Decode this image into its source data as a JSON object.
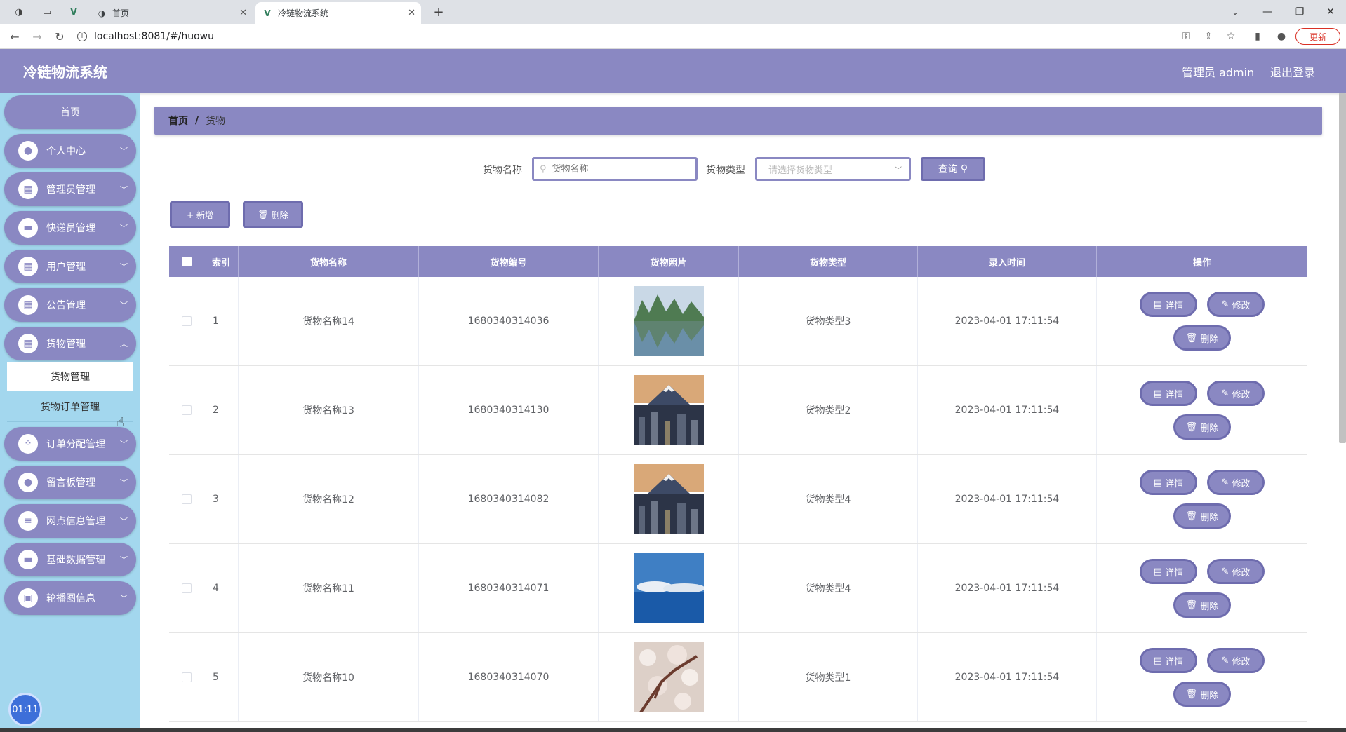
{
  "browser": {
    "tabs": [
      {
        "title": "首页",
        "active": false
      },
      {
        "title": "冷链物流系统",
        "active": true
      }
    ],
    "new_tab": "+",
    "url": "localhost:8081/#/huowu",
    "update_label": "更新"
  },
  "header": {
    "title": "冷链物流系统",
    "user": "管理员 admin",
    "logout": "退出登录"
  },
  "sidebar": {
    "items": [
      {
        "label": "首页",
        "icon": "home"
      },
      {
        "label": "个人中心",
        "icon": "person-icon"
      },
      {
        "label": "管理员管理",
        "icon": "grid-icon"
      },
      {
        "label": "快递员管理",
        "icon": "monitor-icon"
      },
      {
        "label": "用户管理",
        "icon": "grid-icon"
      },
      {
        "label": "公告管理",
        "icon": "grid-icon"
      },
      {
        "label": "货物管理",
        "icon": "grid-icon"
      },
      {
        "label": "订单分配管理",
        "icon": "apps-icon"
      },
      {
        "label": "留言板管理",
        "icon": "person-icon"
      },
      {
        "label": "网点信息管理",
        "icon": "sliders-icon"
      },
      {
        "label": "基础数据管理",
        "icon": "monitor-icon"
      },
      {
        "label": "轮播图信息",
        "icon": "image-icon"
      }
    ],
    "submenu": [
      "货物管理",
      "货物订单管理"
    ],
    "clock": "01:11"
  },
  "breadcrumb": {
    "home": "首页",
    "sep": "/",
    "current": "货物"
  },
  "search": {
    "name_label": "货物名称",
    "name_placeholder": "货物名称",
    "type_label": "货物类型",
    "type_placeholder": "请选择货物类型",
    "query_label": "查询"
  },
  "actions": {
    "add": "+ 新增",
    "delete": "删除"
  },
  "table": {
    "columns": [
      "索引",
      "货物名称",
      "货物编号",
      "货物照片",
      "货物类型",
      "录入时间",
      "操作"
    ],
    "rows": [
      {
        "index": "1",
        "name": "货物名称14",
        "code": "1680340314036",
        "photo": "mountain-lake",
        "type": "货物类型3",
        "time": "2023-04-01 17:11:54"
      },
      {
        "index": "2",
        "name": "货物名称13",
        "code": "1680340314130",
        "photo": "city-fuji",
        "type": "货物类型2",
        "time": "2023-04-01 17:11:54"
      },
      {
        "index": "3",
        "name": "货物名称12",
        "code": "1680340314082",
        "photo": "city-fuji",
        "type": "货物类型4",
        "time": "2023-04-01 17:11:54"
      },
      {
        "index": "4",
        "name": "货物名称11",
        "code": "1680340314071",
        "photo": "sea-sky",
        "type": "货物类型4",
        "time": "2023-04-01 17:11:54"
      },
      {
        "index": "5",
        "name": "货物名称10",
        "code": "1680340314070",
        "photo": "cherry-blossom",
        "type": "货物类型1",
        "time": "2023-04-01 17:11:54"
      }
    ],
    "op_detail": "详情",
    "op_edit": "修改",
    "op_delete": "删除"
  },
  "colors": {
    "accent": "#8a88c2",
    "sidebar": "#a3d7ee"
  }
}
